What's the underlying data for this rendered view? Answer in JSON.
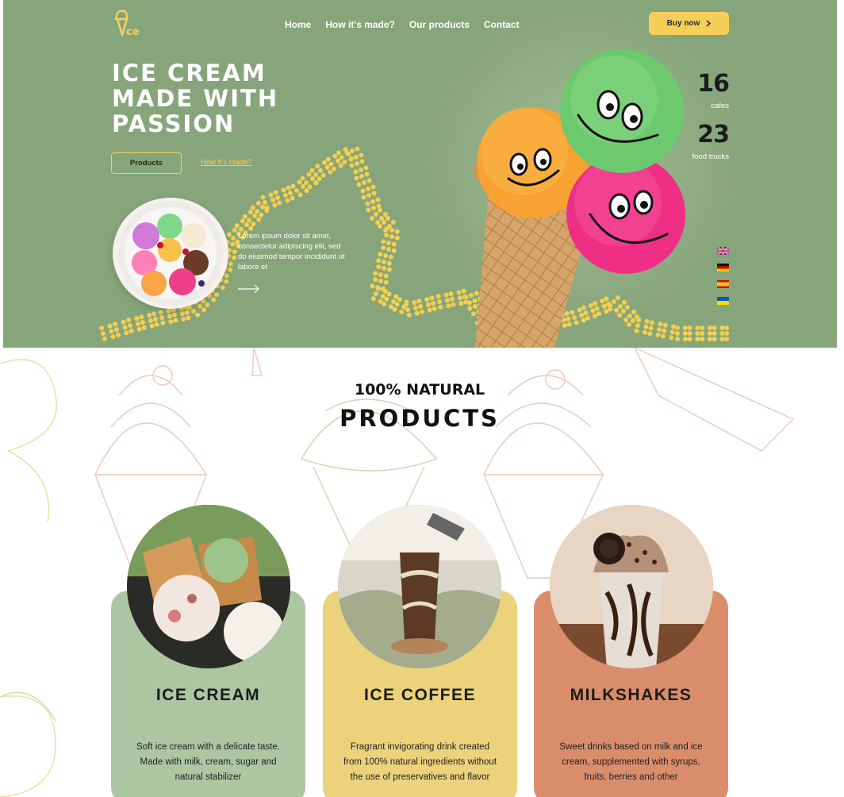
{
  "nav": {
    "items": [
      "Home",
      "How it's made?",
      "Our products",
      "Contact"
    ],
    "buy_label": "Buy now"
  },
  "hero": {
    "headline": [
      "ICE CREAM",
      "MADE WITH",
      "PASSION"
    ],
    "products_button": "Products",
    "how_link": "How it's made?",
    "lorem": "Lorem ipsum dolor sit amet, consectetur adipiscing elit, sed do eiusmod tempor incididunt ut labore et",
    "stats": [
      {
        "value": "16",
        "label": "cafes"
      },
      {
        "value": "23",
        "label": "food trucks"
      }
    ],
    "languages": [
      "english-flag",
      "german-flag",
      "spanish-flag",
      "ukrainian-flag"
    ]
  },
  "products": {
    "subtitle": "100% NATURAL",
    "title": "PRODUCTS",
    "cards": [
      {
        "title": "ICE CREAM",
        "desc": "Soft ice cream with a delicate taste. Made with milk, cream, sugar and natural stabilizer",
        "color": "#adc6a2"
      },
      {
        "title": "ICE COFFEE",
        "desc": "Fragrant invigorating drink created from 100% natural ingredients without the use of preservatives and flavor",
        "color": "#ecd27a"
      },
      {
        "title": "MILKSHAKES",
        "desc": "Sweet drinks based on milk and ice cream, supplemented with syrups, fruits, berries and other",
        "color": "#d98d6a"
      }
    ]
  },
  "colors": {
    "hero_bg": "#87a57b",
    "accent_yellow": "#f6cf5a",
    "card_green": "#adc6a2",
    "card_yellow": "#ecd27a",
    "card_orange": "#d98d6a"
  }
}
